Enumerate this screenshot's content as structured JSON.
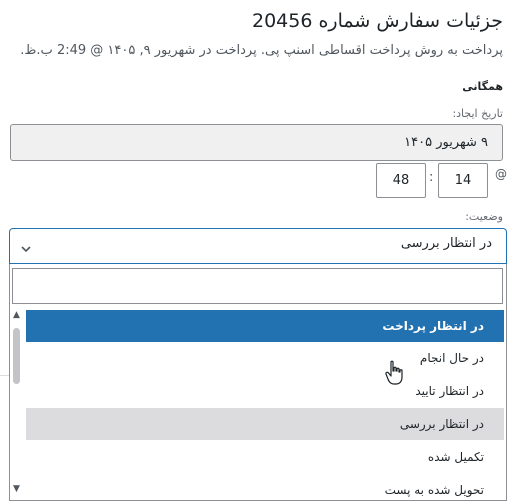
{
  "header": {
    "title": "جزئیات سفارش شماره 20456",
    "subtitle": "پرداخت به روش پرداخت اقساطی اسنپ پی. پرداخت در شهریور ۹, ۱۴۰۵ @ 2:49 ب.ظ."
  },
  "general": {
    "section_title": "همگانی",
    "date_label": "تاریخ ایجاد:",
    "date_value": "۹ شهریور ۱۴۰۵",
    "at_symbol": "@",
    "hour": "14",
    "minute": "48",
    "colon": ":"
  },
  "status": {
    "label": "وضعیت:",
    "selected": "در انتظار بررسی",
    "options": [
      "در انتظار پرداخت",
      "در حال انجام",
      "در انتظار تایید",
      "در انتظار بررسی",
      "تکمیل شده",
      "تحویل شده به پست"
    ],
    "highlighted_index": 0,
    "selected_index": 3
  },
  "colors": {
    "highlight": "#2271b1",
    "selected": "#dcdcde"
  }
}
